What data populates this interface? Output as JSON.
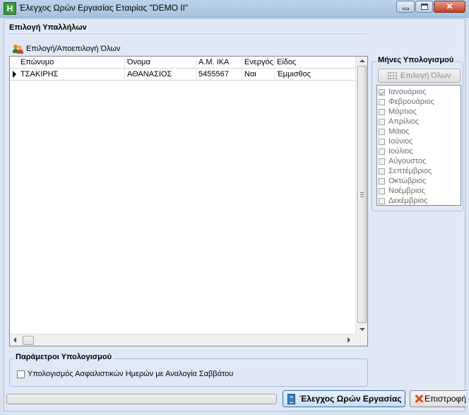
{
  "window": {
    "title": "Έλεγχος Ωρών Εργασίας Εταιρίας \"DEMO II\"",
    "app_icon_letter": "H",
    "close_glyph": "✕"
  },
  "employees_section": {
    "title": "Επιλογή Υπαλλήλων",
    "toggle_all_label": "Επιλογή/Αποεπιλογή Όλων",
    "columns": [
      "Επώνυμο",
      "Όνομα",
      "Α.Μ. ΙΚΑ",
      "Ενεργός",
      "Είδος"
    ],
    "rows": [
      [
        "ΤΣΑΚΙΡΗΣ",
        "ΑΘΑΝΑΣΙΟΣ",
        "5455567",
        "Ναι",
        "Έμμισθος"
      ]
    ]
  },
  "months_section": {
    "title": "Μήνες Υπολογισμού",
    "select_all_label": "Επιλογή Όλων",
    "months": [
      {
        "label": "Ιανουάριος",
        "checked": true
      },
      {
        "label": "Φεβρουάριος",
        "checked": false
      },
      {
        "label": "Μάρτιος",
        "checked": false
      },
      {
        "label": "Απρίλιος",
        "checked": false
      },
      {
        "label": "Μάιος",
        "checked": false
      },
      {
        "label": "Ιούνιος",
        "checked": false
      },
      {
        "label": "Ιούλιος",
        "checked": false
      },
      {
        "label": "Αύγουστος",
        "checked": false
      },
      {
        "label": "Σεπτέμβριος",
        "checked": false
      },
      {
        "label": "Οκτώβριος",
        "checked": false
      },
      {
        "label": "Νοέμβριος",
        "checked": false
      },
      {
        "label": "Δεκέμβριος",
        "checked": false
      }
    ]
  },
  "params_section": {
    "title": "Παράμετροι Υπολογισμού",
    "saturday_ratio_label": "Υπολογισμός Ασφαλιστικών Ημερών με Αναλογία Σαββάτου",
    "saturday_ratio_checked": false
  },
  "footer": {
    "progress": 0,
    "check_button_label": "Έλεγχος Ωρών Εργασίας",
    "return_button_label": "Επιστροφή"
  }
}
